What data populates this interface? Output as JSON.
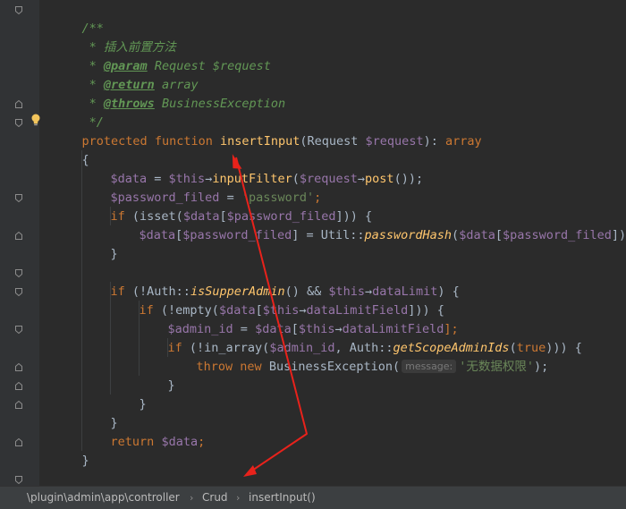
{
  "editor": {
    "doc": {
      "open": "/**",
      "desc": " * 插入前置方法",
      "param_star": " * ",
      "param_tag": "@param",
      "param_type": " Request ",
      "param_var": "$request",
      "return_tag": "@return",
      "return_type": " array",
      "throws_tag": "@throws",
      "throws_type": " BusinessException",
      "close": " */"
    },
    "signature": {
      "kw1": "protected",
      "kw2": "function",
      "name": "insertInput",
      "paren": "(Request ",
      "var": "$request",
      "colon": "): ",
      "ret": "array"
    },
    "brace_open": "{",
    "brace_close": "}",
    "l3": {
      "v1": "$data",
      "eq": " = ",
      "v2": "$this",
      "arrow": "→",
      "fn": "inputFilter",
      "p": "(",
      "v3": "$request",
      "arrow2": "→",
      "fn2": "post",
      "end": "());"
    },
    "l4": {
      "v1": "$password_filed",
      "eq": " = ",
      "str": "'password'",
      "end": ";"
    },
    "l5": {
      "kw": "if",
      "p1": " (isset(",
      "v1": "$data",
      "p2": "[",
      "v2": "$password_filed",
      "end": "])) {"
    },
    "l6": {
      "v1": "$data",
      "p1": "[",
      "v2": "$password_filed",
      "p2": "] = Util::",
      "fn": "passwordHash",
      "p3": "(",
      "v3": "$data",
      "p4": "[",
      "v4": "$password_filed",
      "end": "]);"
    },
    "l8": {
      "kw": "if",
      "p1": " (!Auth::",
      "fn": "isSupperAdmin",
      "p2": "() && ",
      "v1": "$this",
      "arrow": "→",
      "v2": "dataLimit",
      "end": ") {"
    },
    "l9": {
      "kw": "if",
      "p1": " (!empty(",
      "v1": "$data",
      "p2": "[",
      "v2": "$this",
      "arrow": "→",
      "v3": "dataLimitField",
      "end": "])) {"
    },
    "l10": {
      "v1": "$admin_id",
      "eq": " = ",
      "v2": "$data",
      "p1": "[",
      "v3": "$this",
      "arrow": "→",
      "v4": "dataLimitField",
      "end": "];"
    },
    "l11": {
      "kw": "if",
      "p1": " (!in_array(",
      "v1": "$admin_id",
      "p2": ", Auth::",
      "fn": "getScopeAdminIds",
      "p3": "(",
      "kw2": "true",
      "end": "))) {"
    },
    "l12": {
      "kw1": "throw",
      "kw2": "new",
      "p1": " BusinessException(",
      "hint": "message:",
      "str": "'无数据权限'",
      "end": ");"
    },
    "l_return": {
      "kw": "return",
      "v1": "$data",
      "end": ";"
    },
    "next_doc": "/**"
  },
  "statusbar": {
    "path": "\\plugin\\admin\\app\\controller",
    "sep": "›",
    "class": "Crud",
    "method": "insertInput()"
  },
  "colors": {
    "background": "#2b2b2b",
    "gutter": "#313335",
    "keyword": "#cc7832",
    "function": "#ffc66d",
    "variable": "#9876aa",
    "string": "#6a8759",
    "comment": "#629755",
    "annotation_arrow": "#e8221b"
  }
}
